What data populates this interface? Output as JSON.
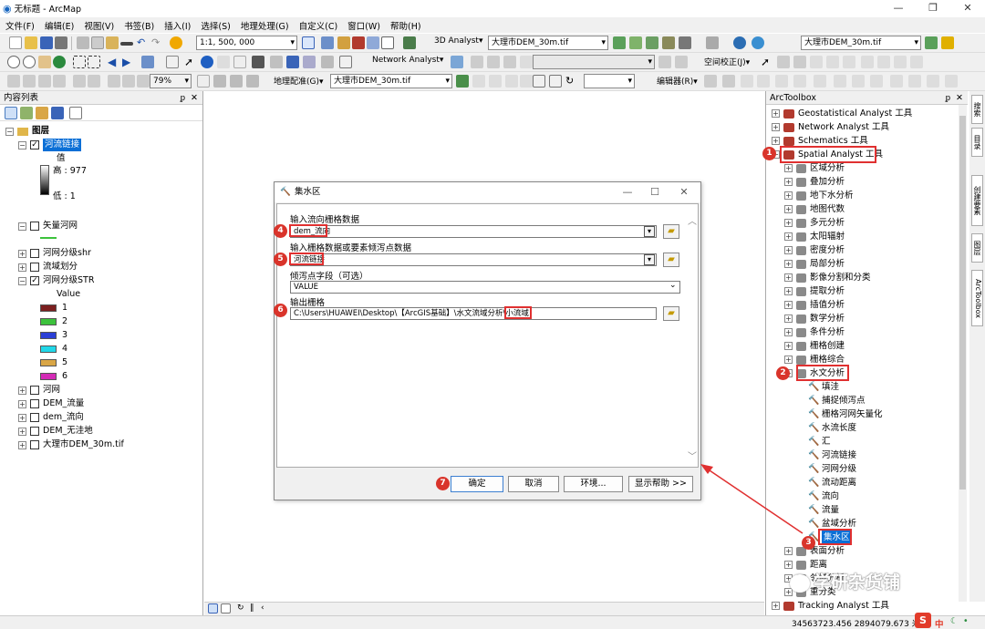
{
  "window": {
    "title": "无标题 - ArcMap",
    "min": "—",
    "max": "❐",
    "close": "✕"
  },
  "menu": [
    "文件(F)",
    "编辑(E)",
    "视图(V)",
    "书签(B)",
    "插入(I)",
    "选择(S)",
    "地理处理(G)",
    "自定义(C)",
    "窗口(W)",
    "帮助(H)"
  ],
  "toolbar1": {
    "scale": "1:1, 500, 000",
    "analyst3d": "3D Analyst▾",
    "layer3d": "大理市DEM_30m.tif",
    "layer_right": "大理市DEM_30m.tif"
  },
  "toolbar2": {
    "zoom": "79%",
    "network": "Network Analyst▾",
    "spatial_adjust": "空间校正(J)▾"
  },
  "toolbar3": {
    "georef": "地理配准(G)▾",
    "georef_layer": "大理市DEM_30m.tif",
    "editor": "编辑器(R)▾"
  },
  "toc": {
    "title": "内容列表",
    "pin": "ᵱ",
    "close": "✕",
    "root": "图层",
    "river_link": "河流链接",
    "value": "值",
    "high": "高 : 977",
    "low": "低 : 1",
    "vector_river": "矢量河网",
    "shr": "河网分级shr",
    "basin": "流域划分",
    "str": "河网分级STR",
    "str_value": "Value",
    "classes": [
      {
        "label": "1",
        "color": "#7b1f1f"
      },
      {
        "label": "2",
        "color": "#3cc23c"
      },
      {
        "label": "3",
        "color": "#2a3fd6"
      },
      {
        "label": "4",
        "color": "#21d7e8"
      },
      {
        "label": "5",
        "color": "#d9a646"
      },
      {
        "label": "6",
        "color": "#d42bb6"
      }
    ],
    "river": "河网",
    "flowacc": "DEM_流量",
    "flowdir": "dem_流向",
    "fill": "DEM_无洼地",
    "dem": "大理市DEM_30m.tif"
  },
  "arctoolbox": {
    "title": "ArcToolbox",
    "top_toolboxes": [
      "Geostatistical Analyst 工具",
      "Network Analyst 工具",
      "Schematics 工具",
      "Spatial Analyst 工具"
    ],
    "spatial_sets": [
      "区域分析",
      "叠加分析",
      "地下水分析",
      "地图代数",
      "多元分析",
      "太阳辐射",
      "密度分析",
      "局部分析",
      "影像分割和分类",
      "提取分析",
      "插值分析",
      "数学分析",
      "条件分析",
      "栅格创建",
      "栅格综合"
    ],
    "hydrology": "水文分析",
    "hydro_tools": [
      "填洼",
      "捕捉倾泻点",
      "栅格河网矢量化",
      "水流长度",
      "汇",
      "河流链接",
      "河网分级",
      "流动距离",
      "流向",
      "流量",
      "盆域分析"
    ],
    "watershed": "集水区",
    "after": [
      "表面分析",
      "距离",
      "邻域分析",
      "重分类"
    ],
    "tracking": "Tracking Analyst 工具"
  },
  "right_tabs": [
    "搜索",
    "目录",
    "创建要素",
    "图层",
    "ArcToolbox"
  ],
  "dialog": {
    "title": "集水区",
    "min": "—",
    "max": "☐",
    "close": "✕",
    "f1_label": "输入流向栅格数据",
    "f1_value": "dem_流向",
    "f2_label": "输入栅格数据或要素倾泻点数据",
    "f2_value": "河流链接",
    "f3_label": "倾泻点字段（可选）",
    "f3_value": "VALUE",
    "f4_label": "输出栅格",
    "f4_value": "C:\\Users\\HUAWEI\\Desktop\\【ArcGIS基础】\\水文流域分析\\小流域",
    "ok": "确定",
    "cancel": "取消",
    "env": "环境...",
    "help": "显示帮助 >>"
  },
  "badges": [
    "1",
    "2",
    "3",
    "4",
    "5",
    "6",
    "7"
  ],
  "status": {
    "coords": "34563723.456  2894079.673 米",
    "ime": "中"
  },
  "watermark": "学研杂货铺",
  "colors": {
    "accent": "#d9342b",
    "selection": "#0a6fd6"
  }
}
